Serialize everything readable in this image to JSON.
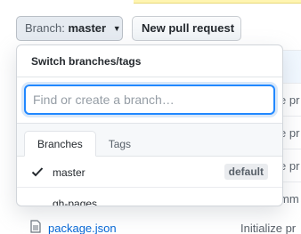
{
  "toolbar": {
    "branch_prefix": "Branch:",
    "branch_name": "master",
    "new_pr_label": "New pull request"
  },
  "background": {
    "commit_messages": [
      "e pr",
      "e pr",
      "e pr",
      "mm"
    ],
    "file": {
      "name": "package.json",
      "message": "Initialize pr"
    }
  },
  "dropdown": {
    "title": "Switch branches/tags",
    "filter_placeholder": "Find or create a branch…",
    "filter_value": "",
    "tabs": [
      {
        "label": "Branches",
        "selected": true
      },
      {
        "label": "Tags",
        "selected": false
      }
    ],
    "items": [
      {
        "name": "master",
        "checked": true,
        "badge": "default"
      },
      {
        "name": "gh-pages",
        "checked": false,
        "badge": ""
      }
    ]
  },
  "colors": {
    "accent": "#2188ff",
    "link": "#0366d6",
    "flash": "#fff5b1",
    "selected_row": "#f1f8ff"
  },
  "icons": {
    "branch_caret": "triangle-down-icon",
    "check": "check-icon",
    "file": "file-icon"
  }
}
